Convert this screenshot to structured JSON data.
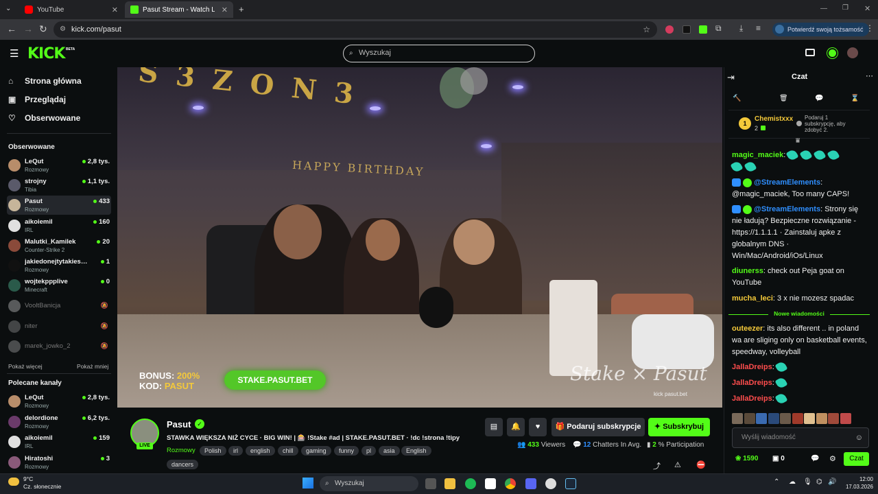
{
  "browser": {
    "tabs": [
      {
        "title": "YouTube",
        "active": false
      },
      {
        "title": "Pasut Stream - Watch Live o",
        "active": true
      }
    ],
    "url": "kick.com/pasut",
    "verify_label": "Potwierdź swoją tożsamość"
  },
  "header": {
    "logo": "KICK",
    "beta": "BETA",
    "search_placeholder": "Wyszukaj"
  },
  "sidebar": {
    "nav": [
      {
        "label": "Strona główna",
        "icon": "home-icon"
      },
      {
        "label": "Przeglądaj",
        "icon": "browse-icon"
      },
      {
        "label": "Obserwowane",
        "icon": "heart-icon"
      }
    ],
    "followed_heading": "Obserwowane",
    "followed": [
      {
        "name": "LeQut",
        "category": "Rozmowy",
        "viewers": "2,8 tys.",
        "live": true
      },
      {
        "name": "strojny",
        "category": "Tibia",
        "viewers": "1,1 tys.",
        "live": true
      },
      {
        "name": "Pasut",
        "category": "Rozmowy",
        "viewers": "433",
        "live": true
      },
      {
        "name": "aikoiemil",
        "category": "IRL",
        "viewers": "160",
        "live": true
      },
      {
        "name": "Malutki_Kamilek",
        "category": "Counter-Strike 2",
        "viewers": "20",
        "live": true
      },
      {
        "name": "jakiedonejtytakiestri...",
        "category": "Rozmowy",
        "viewers": "1",
        "live": true
      },
      {
        "name": "wojtekppplive",
        "category": "Minecraft",
        "viewers": "0",
        "live": true
      },
      {
        "name": "VooltBanicja",
        "category": "",
        "viewers": "",
        "live": false
      },
      {
        "name": "niter",
        "category": "",
        "viewers": "",
        "live": false
      },
      {
        "name": "marek_jowko_2",
        "category": "",
        "viewers": "",
        "live": false
      }
    ],
    "show_more": "Pokaż więcej",
    "show_less": "Pokaż mniej",
    "recommended_heading": "Polecane kanały",
    "recommended": [
      {
        "name": "LeQut",
        "category": "Rozmowy",
        "viewers": "2,8 tys."
      },
      {
        "name": "delordione",
        "category": "Rozmowy",
        "viewers": "6,2 tys."
      },
      {
        "name": "aikoiemil",
        "category": "IRL",
        "viewers": "159"
      },
      {
        "name": "Hiratoshi",
        "category": "Rozmowy",
        "viewers": "3"
      }
    ]
  },
  "video": {
    "bonus_line1": "BONUS:",
    "bonus_value": "200%",
    "kod_line": "KOD:",
    "kod_value": "PASUT",
    "stake_button": "STAKE.PASUT.BET",
    "watermark": "Stake × Pasut",
    "watermark_sub": "kick pasut.bet",
    "banner_text": "HAPPY BIRTHDAY"
  },
  "stream": {
    "streamer": "Pasut",
    "live_badge": "LIVE",
    "title": "STAWKA WIĘKSZA NIŻ CYCE · BIG WIN! | 🎰 !Stake #ad | STAKE.PASUT.BET · !dc !strona !tipy",
    "category": "Rozmowy",
    "tags": [
      "Polish",
      "irl",
      "english",
      "chill",
      "gaming",
      "funny",
      "pl",
      "asia",
      "English",
      "dancers"
    ],
    "gift_label": "Podaruj subskrypcje",
    "subscribe_label": "Subskrybuj",
    "viewers": "433",
    "viewers_label": "Viewers",
    "chatters": "12",
    "chatters_label": "Chatters In Avg.",
    "participation": "2",
    "participation_label": "% Participation"
  },
  "chat": {
    "title": "Czat",
    "pinned_user": "Chemistxxx",
    "pinned_rank": "1",
    "pinned_count": "2",
    "pinned_text": "Podaruj 1 subskrypcję, aby zdobyć 2.",
    "messages": [
      {
        "user": "magic_maciek",
        "color": "#53fc18",
        "text": "",
        "emotes": 6
      },
      {
        "user": "@StreamElements",
        "color": "#2f8fff",
        "text": "@magic_maciek, Too many CAPS!"
      },
      {
        "user": "@StreamElements",
        "color": "#2f8fff",
        "text": "Strony się nie ładują? Bezpieczne rozwiązanie - https://1.1.1.1 · Zainstaluj apke z globalnym DNS · Win/Mac/Android/iOs/Linux"
      },
      {
        "user": "diunerss",
        "color": "#53fc18",
        "text": "check out Peja goat on YouTube"
      },
      {
        "user": "mucha_leci",
        "color": "#f4c93a",
        "text": "3 x nie mozesz spadac"
      },
      {
        "user": "outeezer",
        "color": "#f4c93a",
        "text": "its also different .. in poland wa are sliging only on basketball events, speedway, volleyball"
      },
      {
        "user": "JallaDreips",
        "color": "#ff4d4d",
        "text": "",
        "emotes": 1
      },
      {
        "user": "JallaDreips",
        "color": "#ff4d4d",
        "text": "",
        "emotes": 1
      },
      {
        "user": "JallaDreips",
        "color": "#ff4d4d",
        "text": "",
        "emotes": 1
      }
    ],
    "new_messages": "Nowe wiadomości",
    "input_placeholder": "Wyślij wiadomość",
    "points": "1590",
    "other_count": "0",
    "send_label": "Czat"
  },
  "taskbar": {
    "temp": "9°C",
    "weather": "Cz. słonecznie",
    "search": "Wyszukaj",
    "time": "12:00",
    "date": "17.03.2026"
  },
  "colors": {
    "accent": "#53fc18",
    "background": "#0b0e0f"
  }
}
